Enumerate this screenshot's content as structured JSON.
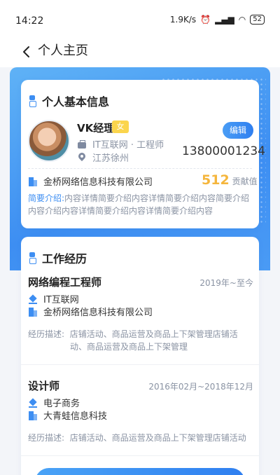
{
  "status_bar": {
    "time": "14:22",
    "speed": "1.9K/s",
    "battery": "52"
  },
  "nav": {
    "title": "个人主页"
  },
  "basic": {
    "section_title": "个人基本信息",
    "name": "VK经理",
    "gender": "女",
    "edit_label": "编辑",
    "job": "IT互联网 · 工程师",
    "location": "江苏徐州",
    "phone": "13800001234",
    "company": "金桥网络信息科技有限公司",
    "contribution_value": "512",
    "contribution_label": "贡献值",
    "intro_label": "简要介绍:",
    "intro_text": "内容详情简要介绍内容详情简要介绍内容简要介绍内容介绍内容详情简要介绍内容详情简要介绍内容"
  },
  "work": {
    "section_title": "工作经历",
    "items": [
      {
        "title": "网络编程工程师",
        "date": "2019年~至今",
        "industry": "IT互联网",
        "company": "金桥网络信息科技有限公司",
        "desc_label": "经历描述:",
        "desc": "店铺活动、商品运营及商品上下架管理店铺活动、商品运营及商品上下架管理"
      },
      {
        "title": "设计师",
        "date": "2016年02月~2018年12月",
        "industry": "电子商务",
        "company": "大青蛙信息科技",
        "desc_label": "经历描述:",
        "desc": "店铺活动、商品运营及商品上下架管理店铺活动"
      }
    ]
  },
  "colors": {
    "primary": "#3d8ef2",
    "accent": "#f5b63d",
    "badge": "#fbd54d"
  }
}
